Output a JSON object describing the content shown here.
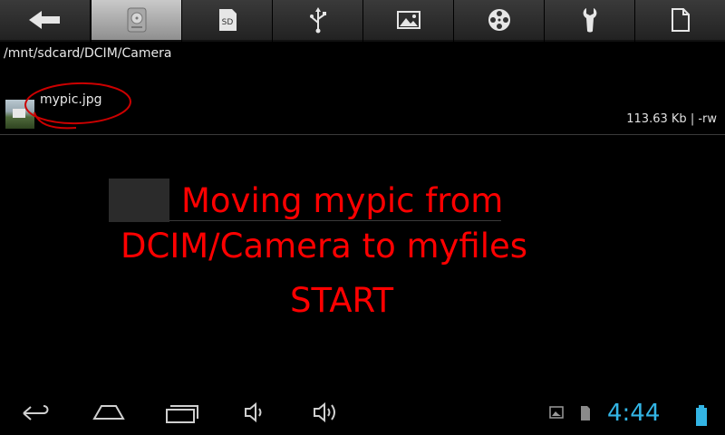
{
  "toolbar": {
    "tabs": [
      {
        "icon": "back-arrow-icon"
      },
      {
        "icon": "internal-storage-icon",
        "active": true
      },
      {
        "icon": "sd-card-icon",
        "label": "SD"
      },
      {
        "icon": "usb-icon"
      },
      {
        "icon": "image-icon"
      },
      {
        "icon": "video-reel-icon"
      },
      {
        "icon": "wrench-icon"
      },
      {
        "icon": "document-icon"
      }
    ]
  },
  "path": "/mnt/sdcard/DCIM/Camera",
  "file": {
    "name": "mypic.jpg",
    "size": "113.63 Kb",
    "permissions": "| -rw",
    "annotation_color": "#cc0000"
  },
  "overlay": {
    "line1": "Moving mypic from",
    "line2": "DCIM/Camera to myfiles",
    "line3": "START",
    "color": "#ff0000"
  },
  "navbar": {
    "buttons": [
      "back-icon",
      "home-icon",
      "recent-apps-icon",
      "volume-down-icon",
      "volume-up-icon"
    ]
  },
  "status": {
    "time": "4:44",
    "time_color": "#33b5e5",
    "icons": [
      "image-notification-icon",
      "sd-notification-icon",
      "battery-icon"
    ]
  }
}
